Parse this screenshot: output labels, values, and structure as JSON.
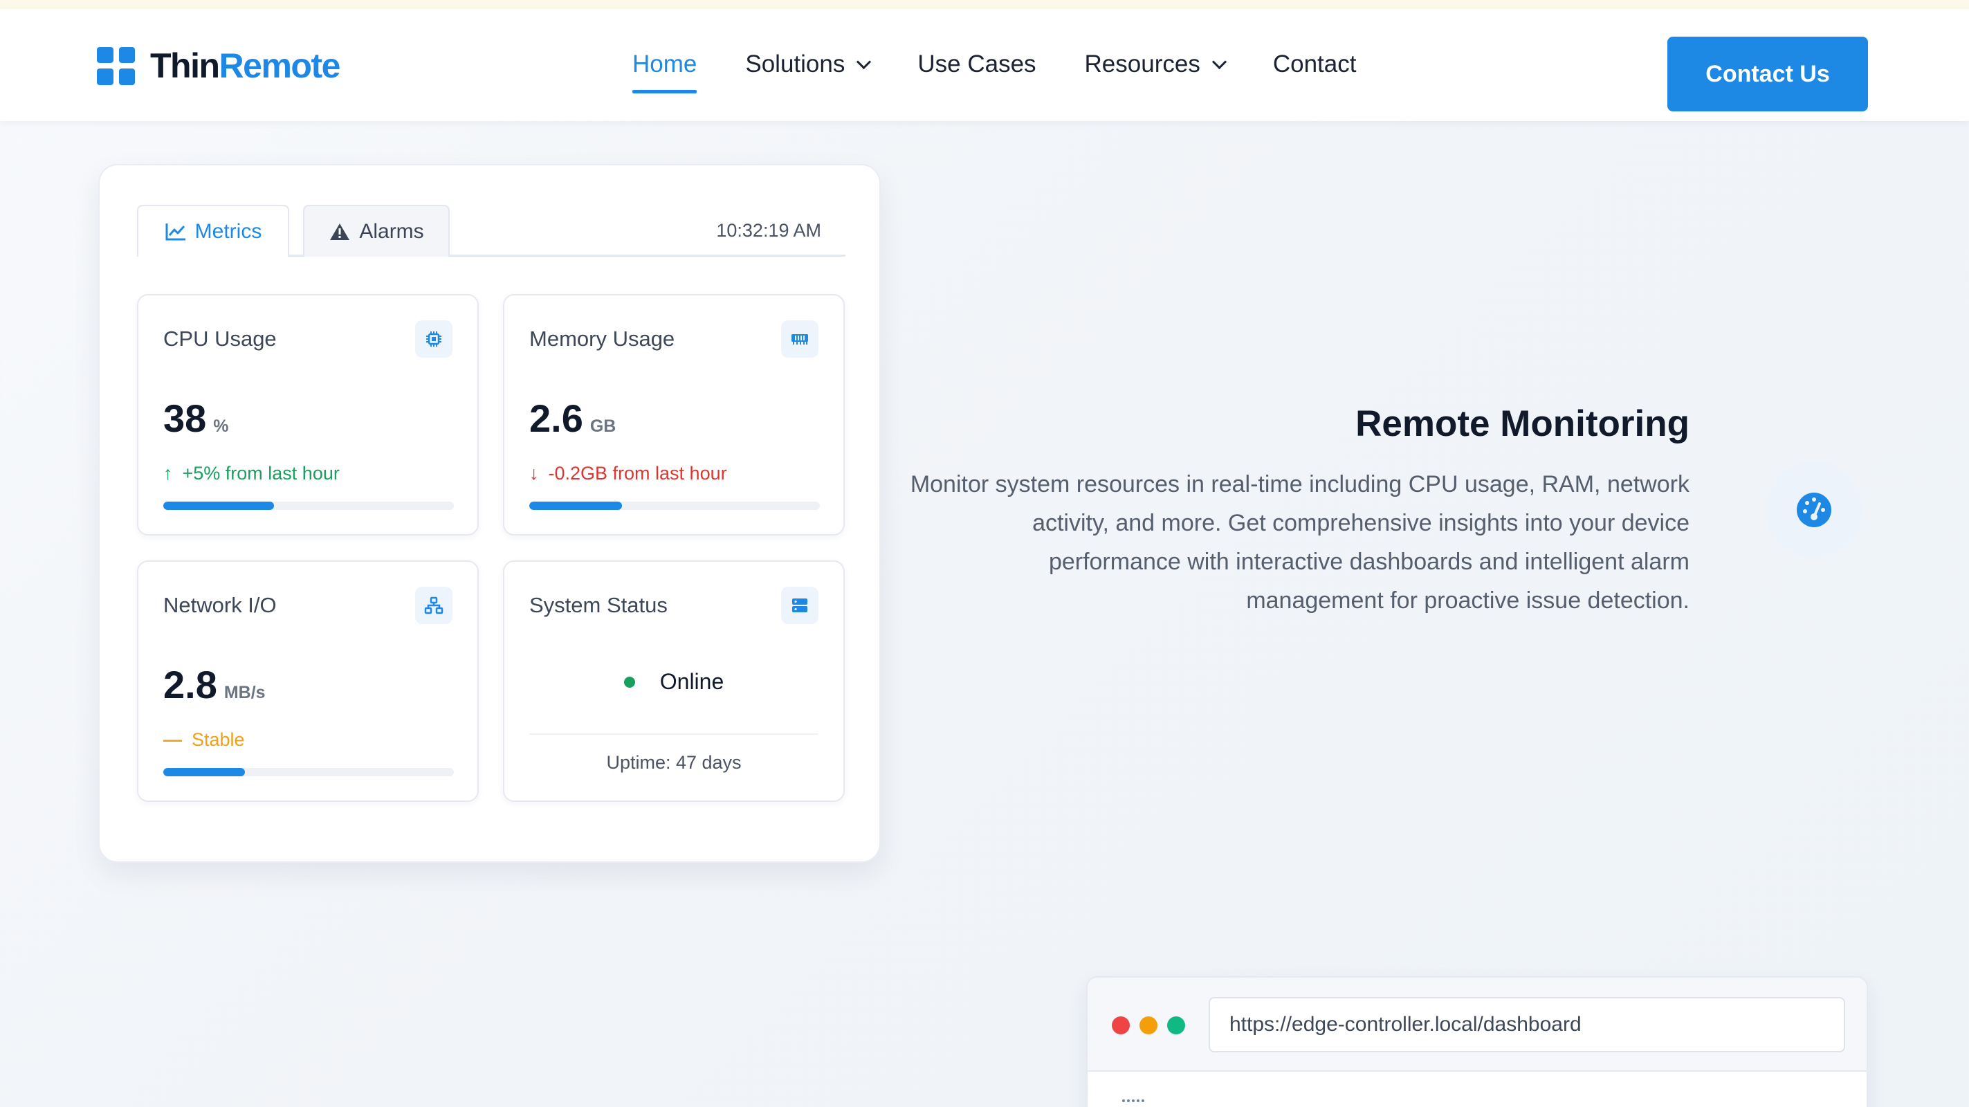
{
  "brand": {
    "name_part1": "Thin",
    "name_part2": "Remote",
    "accent_color": "#1e88e5"
  },
  "nav": {
    "items": [
      {
        "label": "Home",
        "active": true
      },
      {
        "label": "Solutions",
        "dropdown": true
      },
      {
        "label": "Use Cases"
      },
      {
        "label": "Resources",
        "dropdown": true
      },
      {
        "label": "Contact"
      }
    ],
    "cta_label": "Contact Us"
  },
  "dashboard": {
    "tabs": [
      {
        "label": "Metrics",
        "icon": "line-chart-icon",
        "active": true
      },
      {
        "label": "Alarms",
        "icon": "warning-icon"
      }
    ],
    "time": "10:32:19 AM",
    "cards": {
      "cpu": {
        "title": "CPU Usage",
        "icon": "cpu-chip-icon",
        "value": "38",
        "unit": "%",
        "trend_symbol": "↑",
        "trend": "+5% from last hour",
        "trend_color": "#18a05e",
        "progress": 0.38
      },
      "memory": {
        "title": "Memory Usage",
        "icon": "memory-icon",
        "value": "2.6",
        "unit": "GB",
        "trend_symbol": "↓",
        "trend": "-0.2GB from last hour",
        "trend_color": "#e0352f",
        "progress": 0.32
      },
      "network": {
        "title": "Network I/O",
        "icon": "network-icon",
        "value": "2.8",
        "unit": "MB/s",
        "trend_symbol": "—",
        "trend": "Stable",
        "trend_color": "#f0a11b",
        "progress": 0.28
      },
      "status": {
        "title": "System Status",
        "icon": "server-icon",
        "status": "Online",
        "status_color": "#18a05e",
        "uptime": "Uptime: 47 days"
      }
    }
  },
  "feature": {
    "title": "Remote Monitoring",
    "description": "Monitor system resources in real-time including CPU usage, RAM, network activity, and more. Get comprehensive insights into your device performance with interactive dashboards and intelligent alarm management for proactive issue detection.",
    "icon": "speedometer-icon"
  },
  "browser": {
    "url": "https://edge-controller.local/dashboard"
  }
}
